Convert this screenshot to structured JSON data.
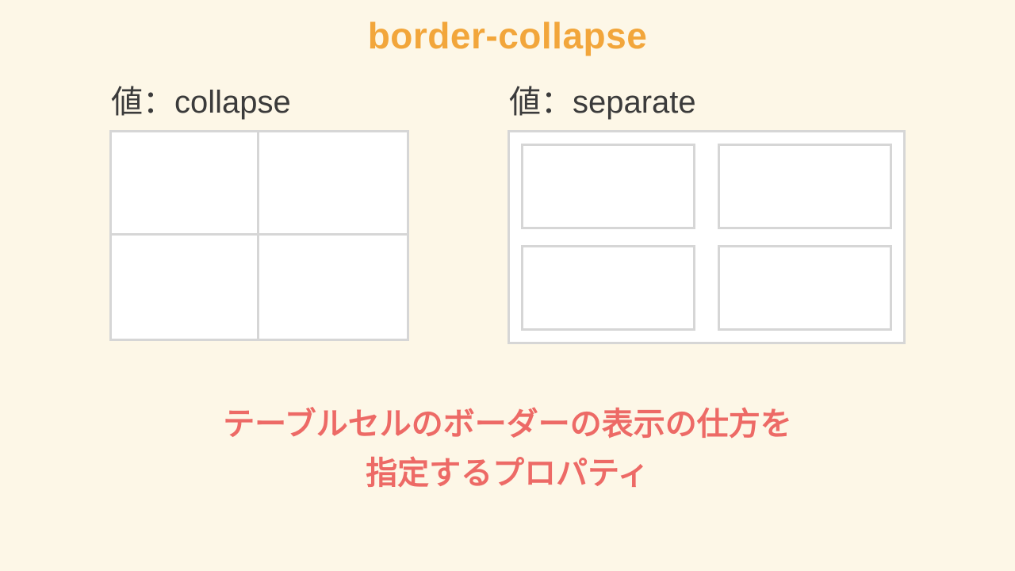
{
  "title": "border-collapse",
  "examples": {
    "collapse": {
      "label": "値：collapse"
    },
    "separate": {
      "label": "値：separate"
    }
  },
  "caption": {
    "line1": "テーブルセルのボーダーの表示の仕方を",
    "line2": "指定するプロパティ"
  },
  "colors": {
    "background": "#fdf7e7",
    "title": "#f2a63b",
    "text": "#3b3b3b",
    "border": "#d6d6d6",
    "caption": "#ed6a66"
  },
  "chart_data": {
    "type": "table",
    "property": "border-collapse",
    "values": [
      "collapse",
      "separate"
    ],
    "grid": {
      "rows": 2,
      "cols": 2
    },
    "description": "テーブルセルのボーダーの表示の仕方を指定するプロパティ"
  }
}
